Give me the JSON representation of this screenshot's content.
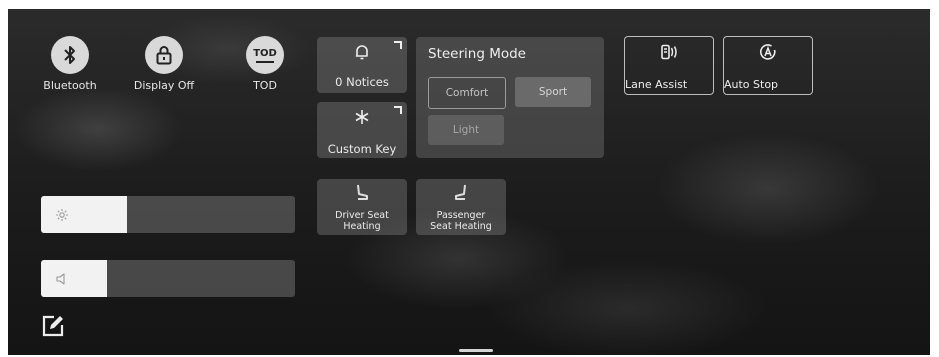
{
  "quick_actions": [
    {
      "label": "Bluetooth",
      "icon": "bluetooth-icon"
    },
    {
      "label": "Display Off",
      "icon": "lock-icon"
    },
    {
      "label": "TOD",
      "icon": "tod-icon",
      "icon_text": "TOD"
    }
  ],
  "notices": {
    "label": "0 Notices",
    "icon": "bell-icon"
  },
  "custom_key": {
    "label": "Custom Key",
    "icon": "asterisk-icon"
  },
  "steering_mode": {
    "title": "Steering Mode",
    "options": [
      "Comfort",
      "Sport",
      "Light"
    ],
    "selected": "Comfort"
  },
  "lane_assist": {
    "label": "Lane Assist",
    "icon": "lane-assist-icon"
  },
  "auto_stop": {
    "label": "Auto Stop",
    "icon": "auto-stop-icon"
  },
  "driver_seat": {
    "line1": "Driver Seat",
    "line2": "Heating",
    "icon": "seat-heating-icon"
  },
  "passenger_seat": {
    "line1": "Passenger",
    "line2": "Seat Heating",
    "icon": "seat-heating-icon"
  },
  "brightness": {
    "level": 0.34,
    "icon": "brightness-icon"
  },
  "volume": {
    "level": 0.26,
    "icon": "volume-icon"
  },
  "edit": {
    "icon": "edit-icon"
  }
}
